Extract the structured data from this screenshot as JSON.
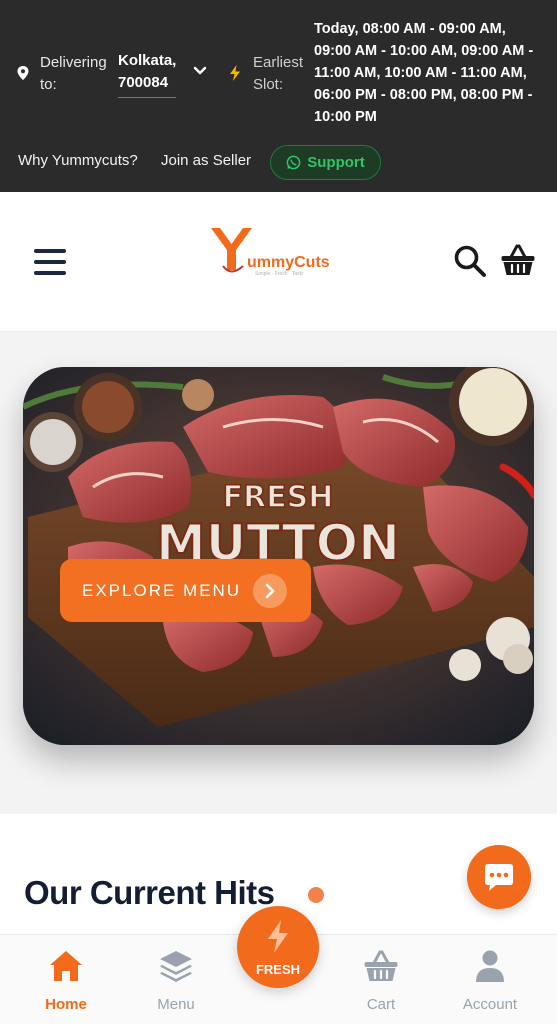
{
  "topbar": {
    "delivering_label": "Delivering to:",
    "location": "Kolkata, 700084",
    "slot_label": "Earliest Slot:",
    "slot_value": "Today, 08:00 AM - 09:00 AM, 09:00 AM - 10:00 AM, 09:00 AM - 11:00 AM, 10:00 AM - 11:00 AM, 06:00 PM - 08:00 PM, 08:00 PM - 10:00 PM",
    "links": {
      "why": "Why Yummycuts?",
      "seller": "Join as Seller",
      "support": "Support"
    }
  },
  "header": {
    "logo_text": "ummyCuts",
    "logo_initial": "Y",
    "logo_tagline": "Simple · Fresh · Tasty"
  },
  "hero": {
    "headline_1": "FRESH",
    "headline_2": "MUTTON",
    "cta": "EXPLORE MENU"
  },
  "section": {
    "title": "Our Current Hits"
  },
  "bottom_nav": {
    "home": "Home",
    "menu": "Menu",
    "fresh": "FRESH",
    "cart": "Cart",
    "account": "Account"
  },
  "colors": {
    "accent": "#f26a1b",
    "topbar_bg": "#2b2b2b",
    "support_green": "#32c565",
    "title_navy": "#141e33"
  }
}
